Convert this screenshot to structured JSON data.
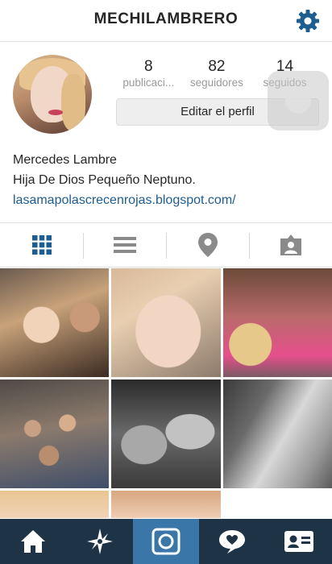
{
  "header": {
    "title": "MECHILAMBRERO",
    "settings_icon": "gear-icon"
  },
  "stats": [
    {
      "value": "8",
      "label": "publicaci..."
    },
    {
      "value": "82",
      "label": "seguidores"
    },
    {
      "value": "14",
      "label": "seguidos"
    }
  ],
  "edit_profile_label": "Editar el perfil",
  "bio": {
    "name": "Mercedes Lambre",
    "description": "Hija De Dios Pequeño Neptuno.",
    "website": "lasamapolascrecenrojas.blogspot.com/"
  },
  "tabs": [
    "grid-view-icon",
    "list-view-icon",
    "map-pin-icon",
    "tagged-photos-icon"
  ],
  "bottom_nav": [
    "home-icon",
    "explore-icon",
    "camera-icon",
    "activity-icon",
    "profile-icon"
  ],
  "colors": {
    "accent": "#1e5d8f",
    "nav_bg": "#1f3347",
    "nav_active": "#3a77a8"
  }
}
